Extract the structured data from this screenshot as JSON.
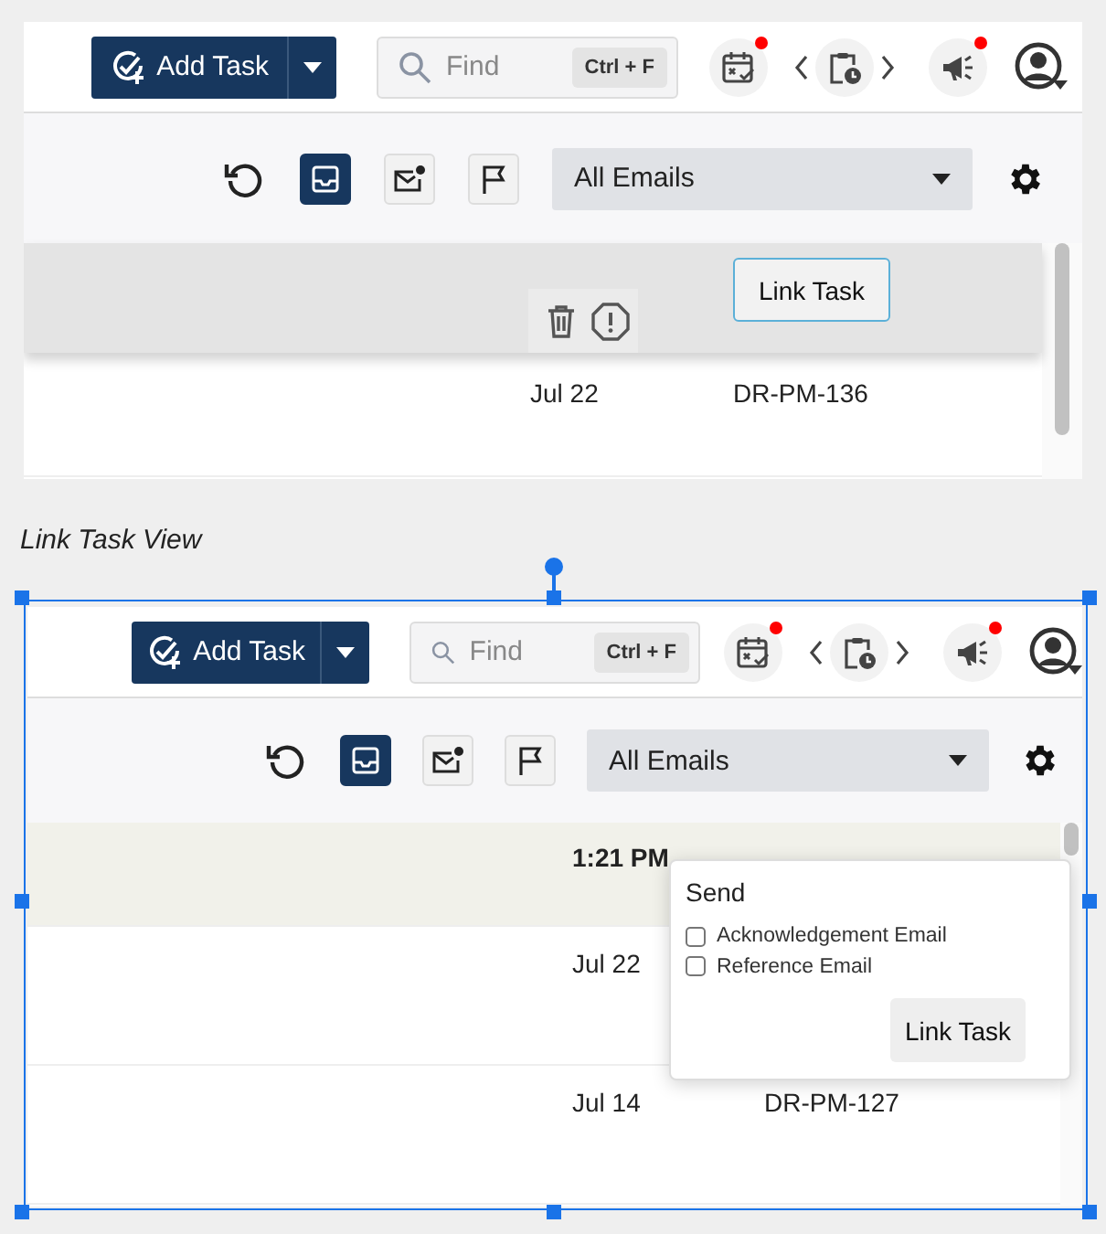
{
  "top_view": {
    "selected": false,
    "header": {
      "add_task": "Add Task",
      "find": {
        "placeholder": "Find"
      },
      "shortcut": "Ctrl + F",
      "icons": [
        {
          "kind": "calendar",
          "badge": true
        },
        {
          "kind": "clipboard",
          "badge": false
        },
        {
          "kind": "megaphone",
          "badge": true
        }
      ]
    },
    "toolbar": {
      "view_buttons": [
        {
          "kind": "inbox",
          "selected": true
        },
        {
          "kind": "mail",
          "selected": false
        },
        {
          "kind": "flag",
          "selected": false
        }
      ],
      "filter": "All Emails"
    },
    "rows": [
      {
        "kind": "hover",
        "button": "Link Task"
      },
      {
        "kind": "plain",
        "date": "Jul 22",
        "id": "DR-PM-136"
      }
    ]
  },
  "caption": "Link Task View",
  "link_task_view": {
    "selected": true,
    "header": {
      "add_task": "Add Task",
      "find": {
        "placeholder": "Find"
      },
      "shortcut": "Ctrl + F",
      "icons": [
        {
          "kind": "calendar",
          "badge": true
        },
        {
          "kind": "clipboard",
          "badge": false
        },
        {
          "kind": "megaphone",
          "badge": true
        }
      ]
    },
    "toolbar": {
      "view_buttons": [
        {
          "kind": "inbox",
          "selected": true
        },
        {
          "kind": "mail",
          "selected": false
        },
        {
          "kind": "flag",
          "selected": false
        }
      ],
      "filter": "All Emails"
    },
    "rows": [
      {
        "kind": "unread",
        "date": "1:21 PM"
      },
      {
        "kind": "plain",
        "date": "Jul 22"
      },
      {
        "kind": "plain",
        "date": "Jul 14",
        "id": "DR-PM-127"
      }
    ],
    "popup": {
      "title": "Send",
      "options": [
        {
          "label": "Acknowledgement Email",
          "checked": false
        },
        {
          "label": "Reference Email",
          "checked": false
        }
      ],
      "button": "Link Task"
    }
  }
}
